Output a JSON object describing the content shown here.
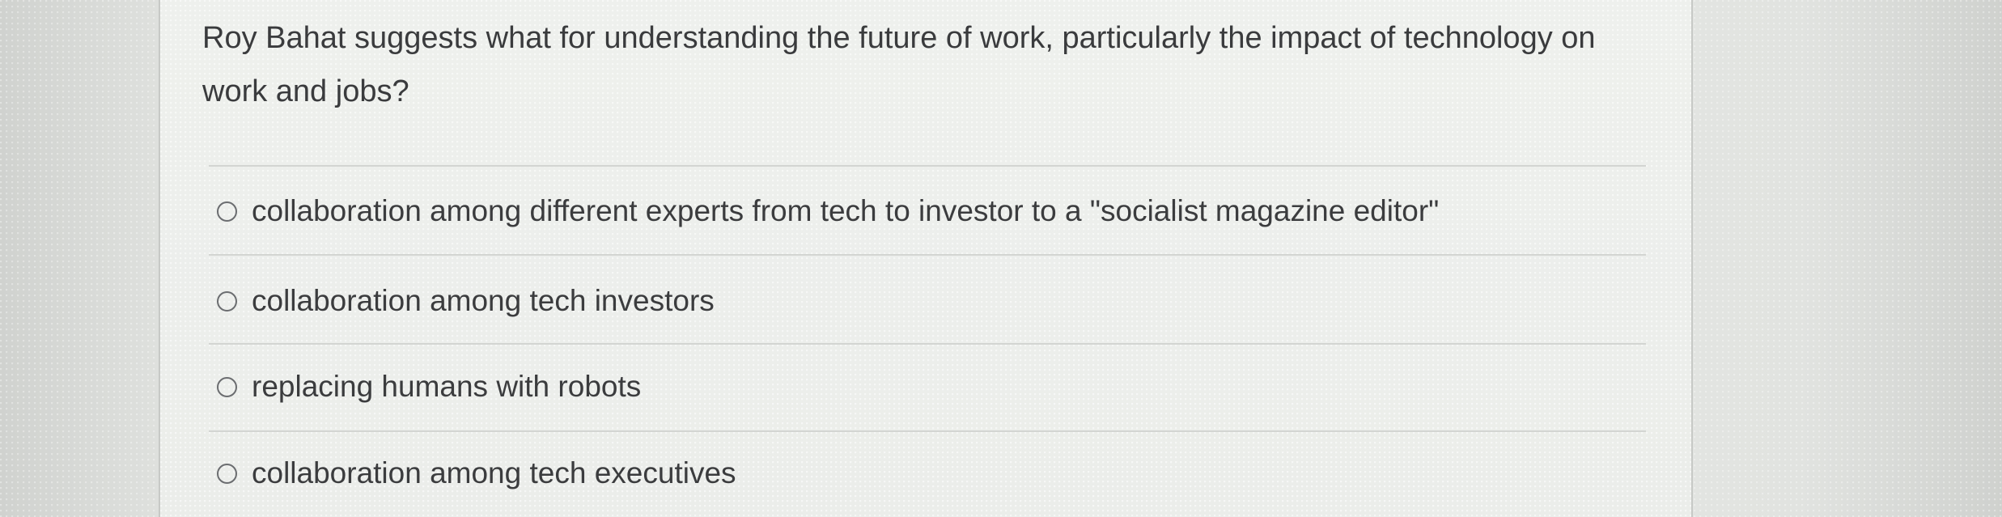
{
  "question": {
    "text": "Roy Bahat suggests what for understanding the future of work, particularly the impact of technology on work and jobs?"
  },
  "options": [
    {
      "label": "collaboration among different experts from tech to investor to a \"socialist magazine editor\"",
      "selected": false
    },
    {
      "label": "collaboration among tech investors",
      "selected": false
    },
    {
      "label": "replacing humans with robots",
      "selected": false
    },
    {
      "label": "collaboration among tech executives",
      "selected": false
    }
  ]
}
